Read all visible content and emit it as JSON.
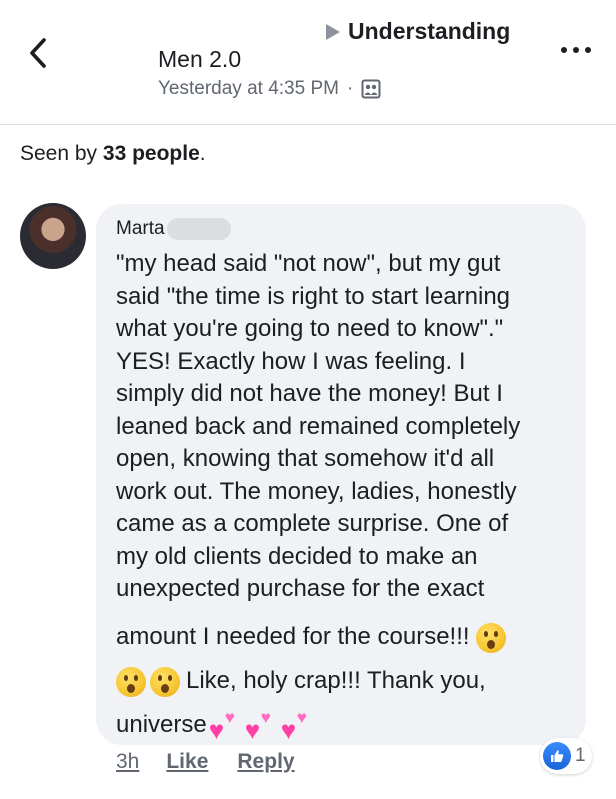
{
  "header": {
    "breadcrumb": "Understanding",
    "group_name": "Men 2.0",
    "timestamp": "Yesterday at 4:35 PM",
    "separator": "·",
    "audience_icon": "group-members-icon"
  },
  "seen": {
    "prefix": "Seen by",
    "count": "33 people",
    "suffix": "."
  },
  "comment": {
    "author": "Marta",
    "lines": [
      "\"my head said \"not now\", but my gut",
      "said \"the time is right to start learning",
      "what you're going to need to know\".\"",
      "YES! Exactly how I was feeling. I",
      "simply did not have the money! But I",
      "leaned back and remained completely",
      "open, knowing that somehow it'd all",
      "work out. The money, ladies, honestly",
      "came as a complete surprise. One of",
      "my old clients decided to make an",
      "unexpected purchase for the exact"
    ],
    "line_12": "amount I needed for the course!!!",
    "line_13": "Like, holy crap!!! Thank you,",
    "line_14": "universe",
    "emojis": {
      "wow": "astonished-face-emoji",
      "hearts": "two-hearts-emoji"
    },
    "time": "3h",
    "like_label": "Like",
    "reply_label": "Reply",
    "reaction_count": "1",
    "reaction_icon": "thumbs-up-icon"
  },
  "colors": {
    "bubble": "#f0f2f5",
    "text": "#1c1e21",
    "secondary": "#606770",
    "like_blue": "#1877f2",
    "hearts": "#ff3fa6"
  }
}
